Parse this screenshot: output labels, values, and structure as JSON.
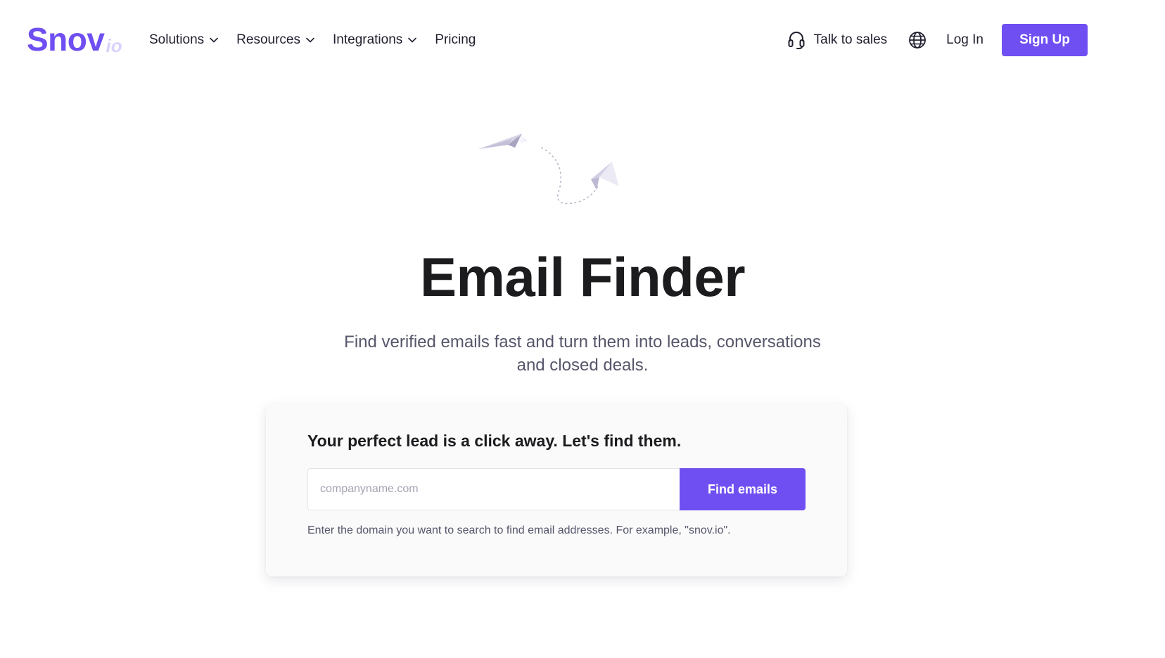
{
  "brand": {
    "logo_main": "Snov",
    "logo_sub": "io",
    "accent_color": "#6f4ff2"
  },
  "nav": {
    "items": [
      {
        "label": "Solutions",
        "has_dropdown": true
      },
      {
        "label": "Resources",
        "has_dropdown": true
      },
      {
        "label": "Integrations",
        "has_dropdown": true
      },
      {
        "label": "Pricing",
        "has_dropdown": false
      }
    ],
    "talk_to_sales": "Talk to sales",
    "language_icon": "globe-icon",
    "login": "Log In",
    "signup": "Sign Up"
  },
  "hero": {
    "illustration": "paper-planes-illustration",
    "title": "Email Finder",
    "subtitle": "Find verified emails fast and turn them into leads, conversations and closed deals."
  },
  "search": {
    "heading": "Your perfect lead is a click away. Let's find them.",
    "placeholder": "companyname.com",
    "value": "",
    "button": "Find emails",
    "hint": "Enter the domain you want to search to find email addresses. For example, \"snov.io\"."
  }
}
